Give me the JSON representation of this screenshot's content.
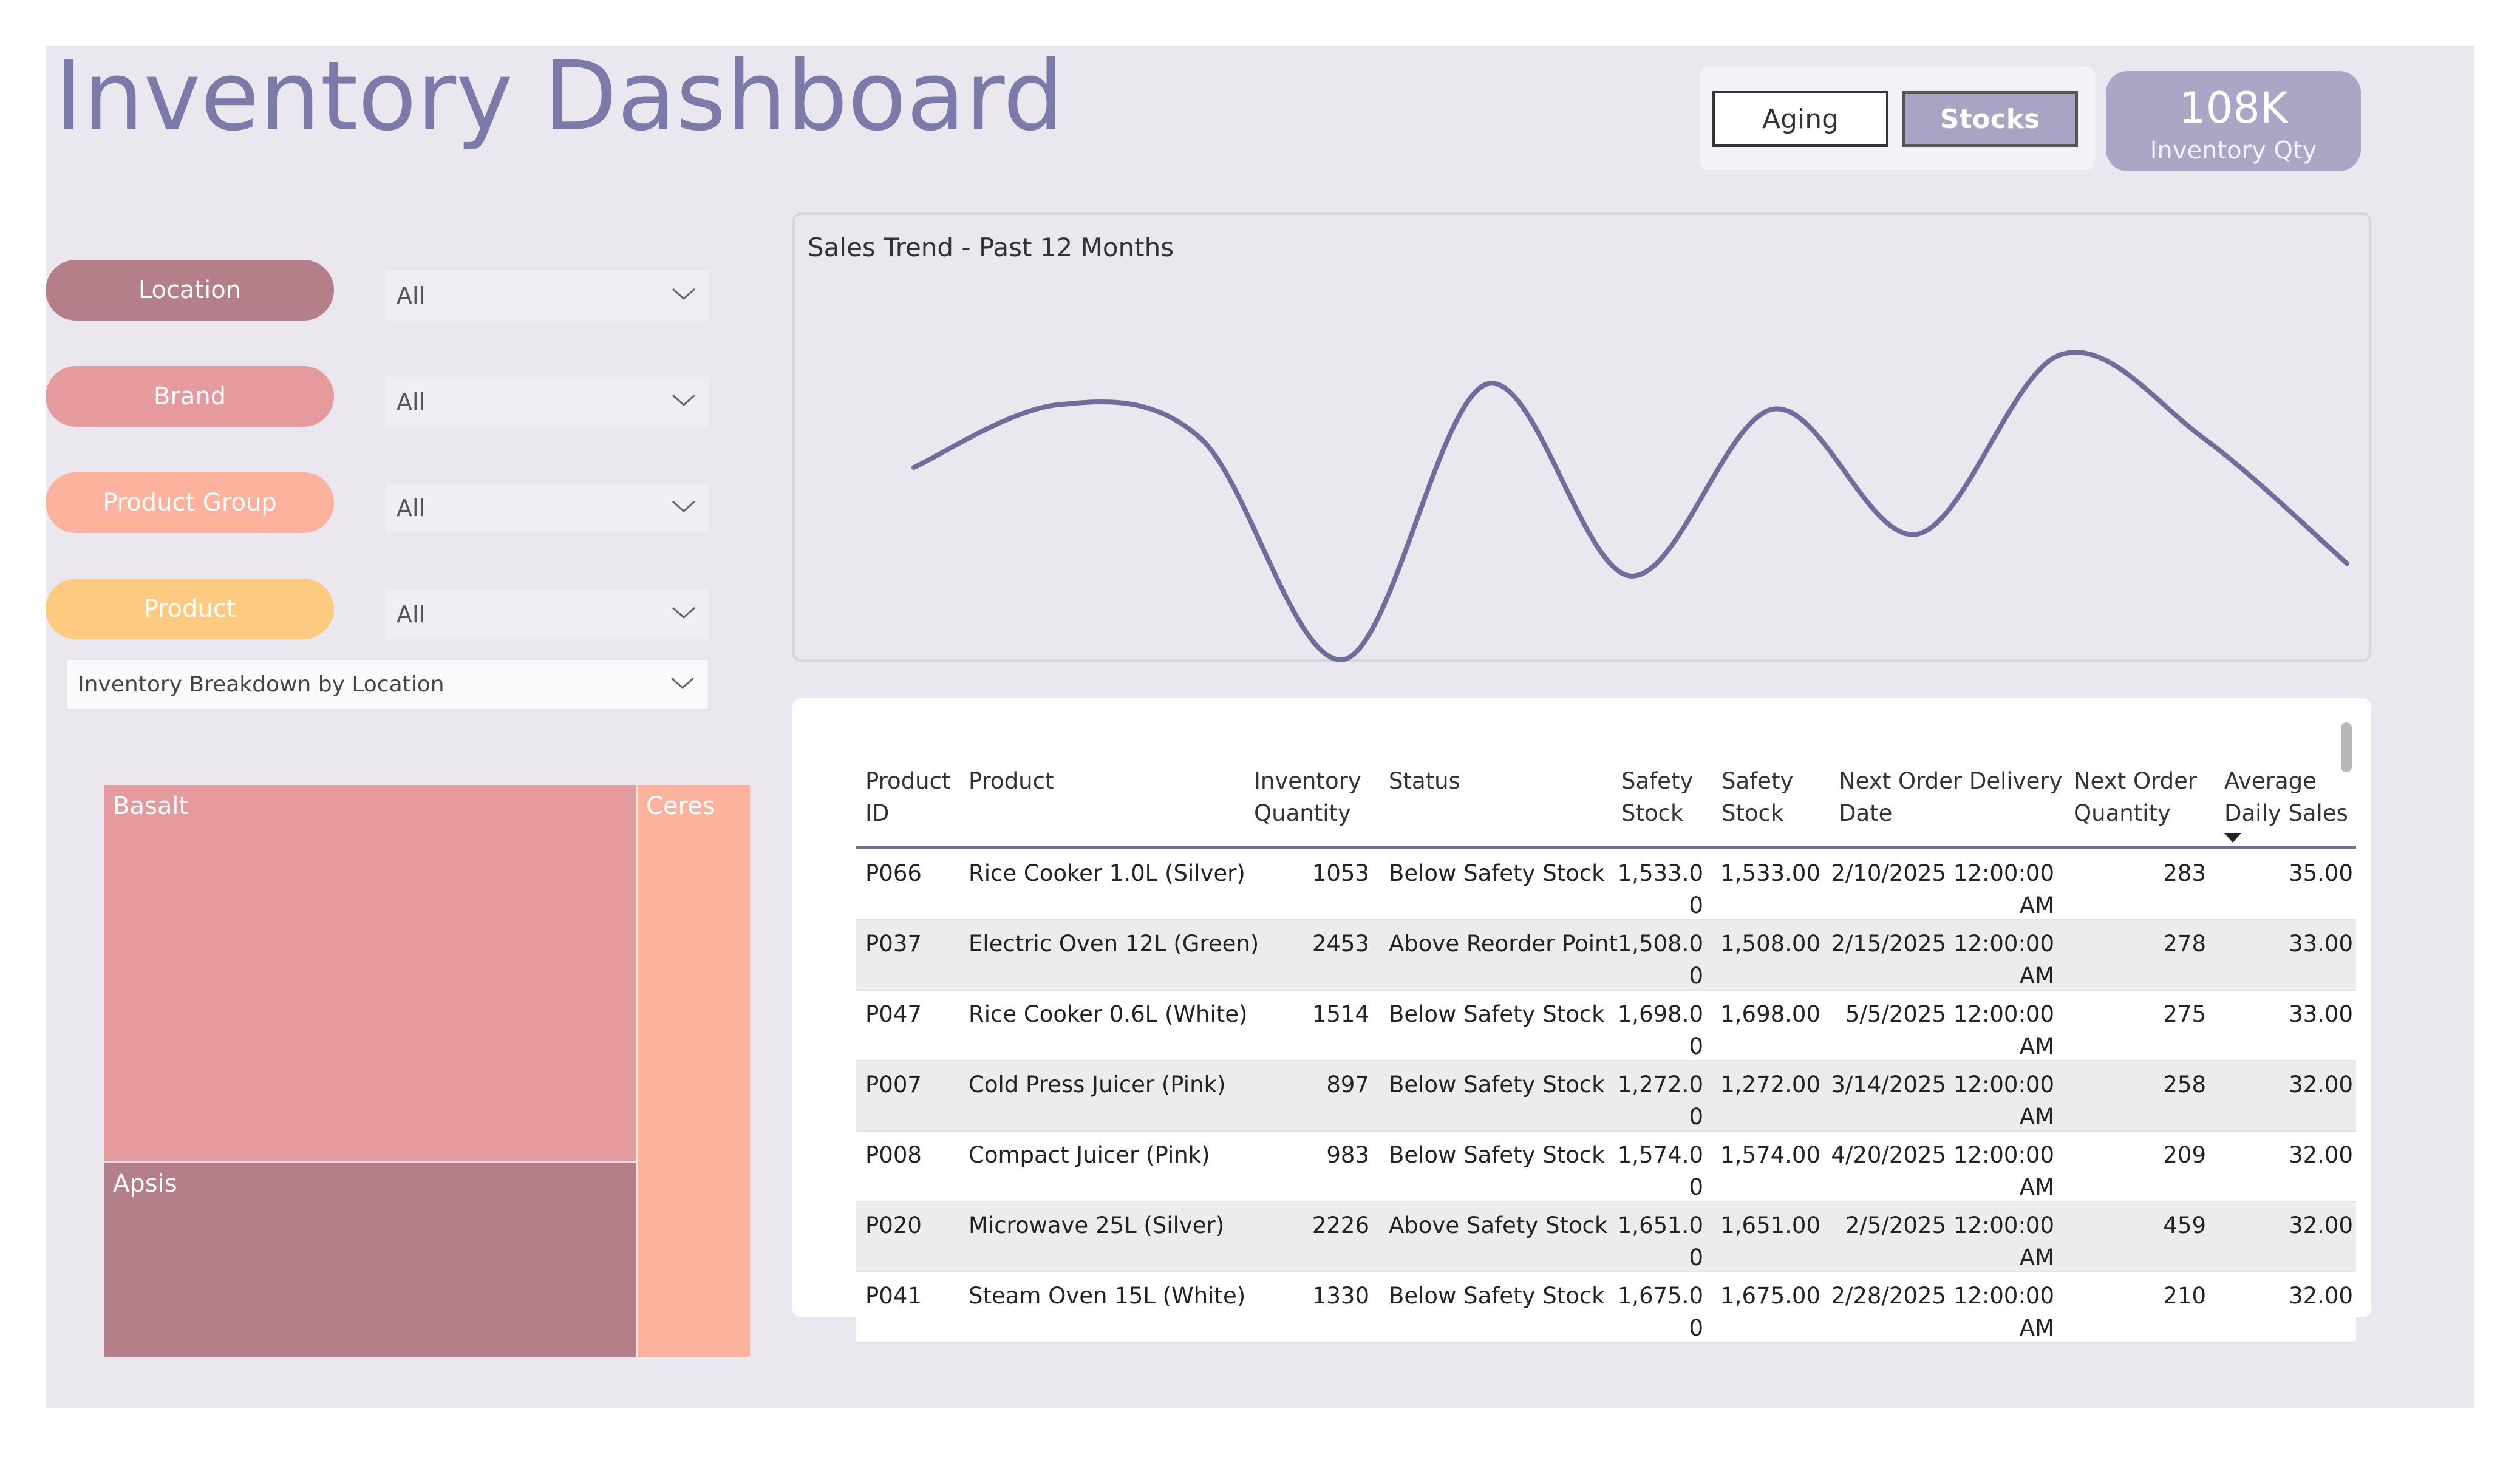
{
  "header": {
    "title": "Inventory Dashboard"
  },
  "toggle": {
    "aging_label": "Aging",
    "stocks_label": "Stocks",
    "active": "Stocks"
  },
  "kpi": {
    "value": "108K",
    "label": "Inventory Qty",
    "color": "#aaa6c6"
  },
  "filters": [
    {
      "label": "Location",
      "value": "All",
      "color": "#b57f8a"
    },
    {
      "label": "Brand",
      "value": "All",
      "color": "#e59a9d"
    },
    {
      "label": "Product Group",
      "value": "All",
      "color": "#fcb29d"
    },
    {
      "label": "Product",
      "value": "All",
      "color": "#fdca82"
    }
  ],
  "breakdown": {
    "dropdown_label": "Inventory Breakdown by Location",
    "treemap": [
      {
        "name": "Basalt",
        "color": "#e59a9d"
      },
      {
        "name": "Apsis",
        "color": "#b57f8a"
      },
      {
        "name": "Ceres",
        "color": "#fcb29d"
      }
    ]
  },
  "chart": {
    "title": "Sales Trend - Past 12 Months",
    "line_color": "#6e6d9c"
  },
  "chart_data": {
    "type": "line",
    "title": "Sales Trend - Past 12 Months",
    "xlabel": "",
    "ylabel": "",
    "values": [
      48,
      63,
      55,
      2,
      68,
      22,
      62,
      32,
      75,
      55,
      25
    ],
    "ylim": [
      0,
      80
    ],
    "grid": false
  },
  "table": {
    "headers": {
      "product_id": [
        "Product",
        "ID"
      ],
      "product": [
        "Product",
        ""
      ],
      "inventory_quantity": [
        "Inventory",
        "Quantity"
      ],
      "status": [
        "Status",
        ""
      ],
      "safety_stock_a": [
        "Safety",
        "Stock"
      ],
      "safety_stock_b": [
        "Safety",
        "Stock"
      ],
      "next_order_delivery_date": [
        "Next Order Delivery",
        "Date"
      ],
      "next_order_quantity": [
        "Next Order",
        "Quantity"
      ],
      "average_daily_sales": [
        "Average",
        "Daily Sales"
      ]
    },
    "sort_column": "Average Daily Sales",
    "rows": [
      {
        "id": "P066",
        "product": "Rice Cooker 1.0L (Silver)",
        "qty": "1053",
        "status": "Below Safety Stock",
        "ss_a": [
          "1,533.0",
          "0"
        ],
        "ss_b": "1,533.00",
        "date": [
          "2/10/2025 12:00:00",
          "AM"
        ],
        "next_qty": "283",
        "avg": "35.00"
      },
      {
        "id": "P037",
        "product": "Electric Oven 12L (Green)",
        "qty": "2453",
        "status": "Above Reorder Point",
        "ss_a": [
          "1,508.0",
          "0"
        ],
        "ss_b": "1,508.00",
        "date": [
          "2/15/2025 12:00:00",
          "AM"
        ],
        "next_qty": "278",
        "avg": "33.00"
      },
      {
        "id": "P047",
        "product": "Rice Cooker 0.6L (White)",
        "qty": "1514",
        "status": "Below Safety Stock",
        "ss_a": [
          "1,698.0",
          "0"
        ],
        "ss_b": "1,698.00",
        "date": [
          "5/5/2025 12:00:00",
          "AM"
        ],
        "next_qty": "275",
        "avg": "33.00"
      },
      {
        "id": "P007",
        "product": "Cold Press Juicer (Pink)",
        "qty": "897",
        "status": "Below Safety Stock",
        "ss_a": [
          "1,272.0",
          "0"
        ],
        "ss_b": "1,272.00",
        "date": [
          "3/14/2025 12:00:00",
          "AM"
        ],
        "next_qty": "258",
        "avg": "32.00"
      },
      {
        "id": "P008",
        "product": "Compact Juicer (Pink)",
        "qty": "983",
        "status": "Below Safety Stock",
        "ss_a": [
          "1,574.0",
          "0"
        ],
        "ss_b": "1,574.00",
        "date": [
          "4/20/2025 12:00:00",
          "AM"
        ],
        "next_qty": "209",
        "avg": "32.00"
      },
      {
        "id": "P020",
        "product": "Microwave 25L (Silver)",
        "qty": "2226",
        "status": "Above Safety Stock",
        "ss_a": [
          "1,651.0",
          "0"
        ],
        "ss_b": "1,651.00",
        "date": [
          "2/5/2025 12:00:00",
          "AM"
        ],
        "next_qty": "459",
        "avg": "32.00"
      },
      {
        "id": "P041",
        "product": "Steam Oven 15L (White)",
        "qty": "1330",
        "status": "Below Safety Stock",
        "ss_a": [
          "1,675.0",
          "0"
        ],
        "ss_b": "1,675.00",
        "date": [
          "2/28/2025 12:00:00",
          "AM"
        ],
        "next_qty": "210",
        "avg": "32.00"
      }
    ]
  }
}
